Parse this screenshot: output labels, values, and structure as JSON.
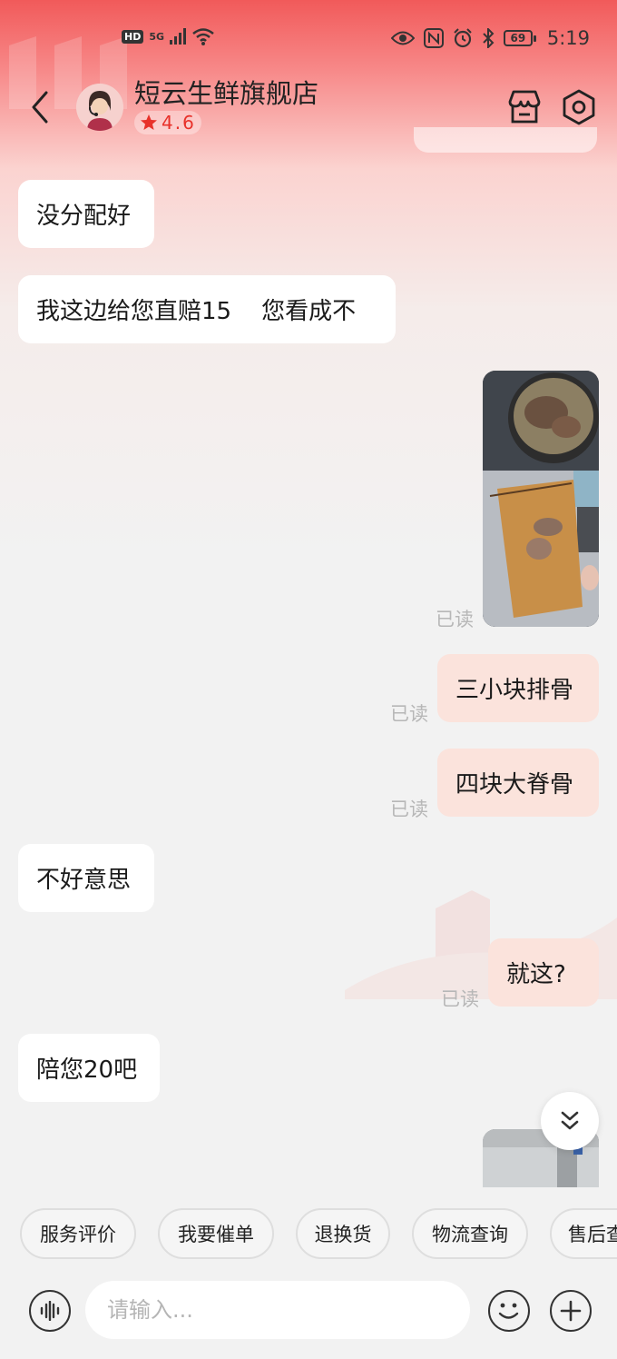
{
  "status_bar": {
    "hd": "HD",
    "network": "5G",
    "battery": "69",
    "time": "5:19"
  },
  "header": {
    "shop_name": "短云生鲜旗舰店",
    "rating": "4.6",
    "icons": [
      "back-icon",
      "store-icon",
      "settings-icon"
    ]
  },
  "messages": [
    {
      "side": "in",
      "text": "没分配好"
    },
    {
      "side": "in",
      "text": "我这边给您直赔15    您看成不"
    },
    {
      "side": "out",
      "type": "image",
      "read": "已读"
    },
    {
      "side": "out",
      "text": "三小块排骨",
      "read": "已读"
    },
    {
      "side": "out",
      "text": "四块大脊骨",
      "read": "已读"
    },
    {
      "side": "in",
      "text": "不好意思"
    },
    {
      "side": "out",
      "text": "就这?",
      "read": "已读"
    },
    {
      "side": "in",
      "text": "陪您20吧"
    },
    {
      "side": "out",
      "type": "image"
    }
  ],
  "quick_actions": [
    "服务评价",
    "我要催单",
    "退换货",
    "物流查询",
    "售后查"
  ],
  "input": {
    "placeholder": "请输入..."
  },
  "colors": {
    "accent": "#e8312a",
    "out_bubble": "#fbe3dc",
    "in_bubble": "#ffffff"
  }
}
